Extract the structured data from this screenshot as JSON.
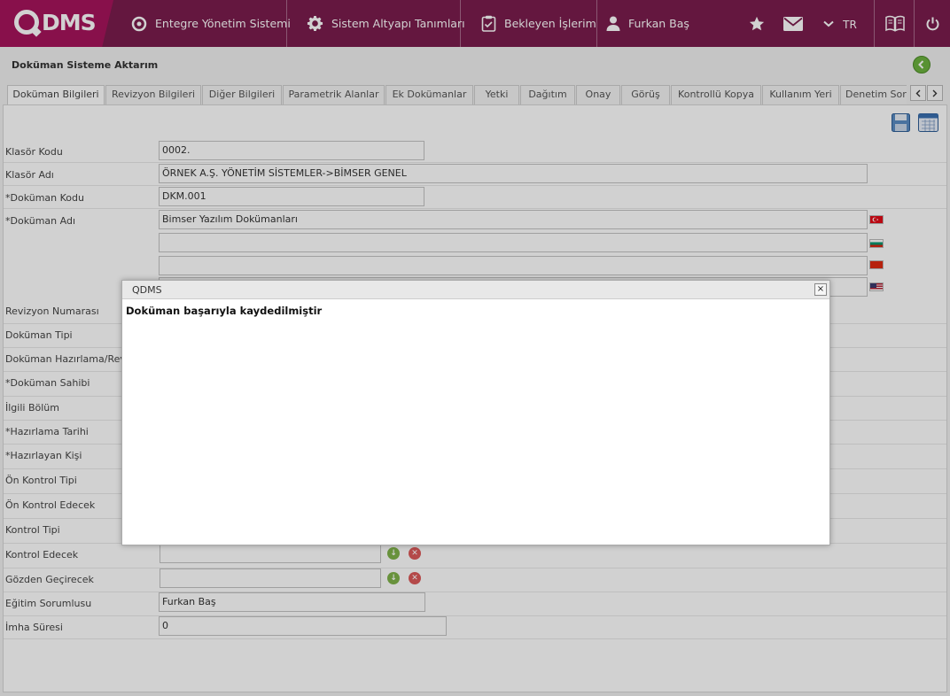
{
  "header": {
    "logo_text": "DMS",
    "nav": {
      "integrated": "Entegre Yönetim Sistemi",
      "infrastructure": "Sistem Altyapı Tanımları",
      "pending": "Bekleyen İşlerim",
      "user": "Furkan Baş"
    },
    "language": "TR"
  },
  "page": {
    "title": "Doküman Sisteme Aktarım"
  },
  "tabs": [
    "Doküman Bilgileri",
    "Revizyon Bilgileri",
    "Diğer Bilgileri",
    "Parametrik Alanlar",
    "Ek Dokümanlar",
    "Yetki",
    "Dağıtım",
    "Onay",
    "Görüş",
    "Kontrollü Kopya",
    "Kullanım Yeri",
    "Denetim Sor"
  ],
  "form": {
    "klasor_kodu": {
      "label": "Klasör Kodu",
      "value": "0002."
    },
    "klasor_adi": {
      "label": "Klasör Adı",
      "value": "ÖRNEK A.Ş. YÖNETİM SİSTEMLER->BİMSER GENEL"
    },
    "dokuman_kodu": {
      "label": "*Doküman Kodu",
      "value": "DKM.001"
    },
    "dokuman_adi": {
      "label": "*Doküman Adı",
      "value": "Bimser Yazılım Dokümanları",
      "value_2": "",
      "value_3": "",
      "value_4": ""
    },
    "revizyon_numarasi": {
      "label": "Revizyon Numarası"
    },
    "dokuman_tipi": {
      "label": "Doküman Tipi"
    },
    "hazirlama": {
      "label": "Doküman Hazırlama/Revizyon"
    },
    "dokuman_sahibi": {
      "label": "*Doküman Sahibi"
    },
    "ilgili_bolum": {
      "label": "İlgili Bölüm"
    },
    "hazirlama_tarihi": {
      "label": "*Hazırlama Tarihi"
    },
    "hazirlayan_kisi": {
      "label": "*Hazırlayan Kişi"
    },
    "on_kontrol_tipi": {
      "label": "Ön Kontrol Tipi"
    },
    "on_kontrol_edecek": {
      "label": "Ön Kontrol Edecek"
    },
    "kontrol_tipi": {
      "label": "Kontrol Tipi"
    },
    "kontrol_edecek": {
      "label": "Kontrol Edecek",
      "value": ""
    },
    "gozden_gecirecek": {
      "label": "Gözden Geçirecek",
      "value": ""
    },
    "egitim_sorumlusu": {
      "label": "Eğitim Sorumlusu",
      "value": "Furkan Baş"
    },
    "imha_suresi": {
      "label": "İmha Süresi",
      "value": "0"
    }
  },
  "modal": {
    "title": "QDMS",
    "close_label": "×",
    "message": "Doküman başarıyla kaydedilmiştir"
  },
  "colors": {
    "topbar": "#7b1d4d",
    "logo_bg": "#a7145c",
    "back_button": "#6cb33f"
  }
}
